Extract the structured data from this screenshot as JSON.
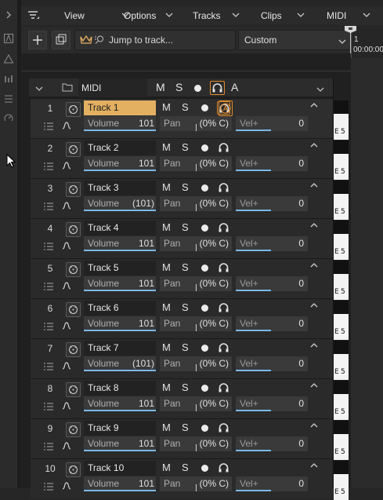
{
  "menubar": {
    "items": [
      "View",
      "Options",
      "Tracks",
      "Clips",
      "MIDI"
    ]
  },
  "controlbar": {
    "jump_placeholder": "Jump to track...",
    "custom_label": "Custom"
  },
  "ruler": {
    "bar": "1",
    "time": "00:00:00:"
  },
  "folder": {
    "name": "MIDI",
    "m": "M",
    "s": "S",
    "a": "A"
  },
  "colors": {
    "accent": "#e3b062",
    "monitor_active": "#e08a2c",
    "volume_bar": "#7bb8e6"
  },
  "tracks": [
    {
      "num": "1",
      "name": "Track 1",
      "vol": "101",
      "selected": true
    },
    {
      "num": "2",
      "name": "Track 2",
      "vol": "101"
    },
    {
      "num": "3",
      "name": "Track 3",
      "vol": "(101)"
    },
    {
      "num": "4",
      "name": "Track 4",
      "vol": "101"
    },
    {
      "num": "5",
      "name": "Track 5",
      "vol": "101"
    },
    {
      "num": "6",
      "name": "Track 6",
      "vol": "101"
    },
    {
      "num": "7",
      "name": "Track 7",
      "vol": "(101)"
    },
    {
      "num": "8",
      "name": "Track 8",
      "vol": "101"
    },
    {
      "num": "9",
      "name": "Track 9",
      "vol": "101"
    },
    {
      "num": "10",
      "name": "Track 10",
      "vol": "101"
    }
  ],
  "track_labels": {
    "m": "M",
    "s": "S",
    "volume": "Volume",
    "pan": "Pan",
    "pan_value": "(0% C)",
    "vel": "Vel+",
    "vel_value": "0"
  },
  "clip_label": "E 5"
}
